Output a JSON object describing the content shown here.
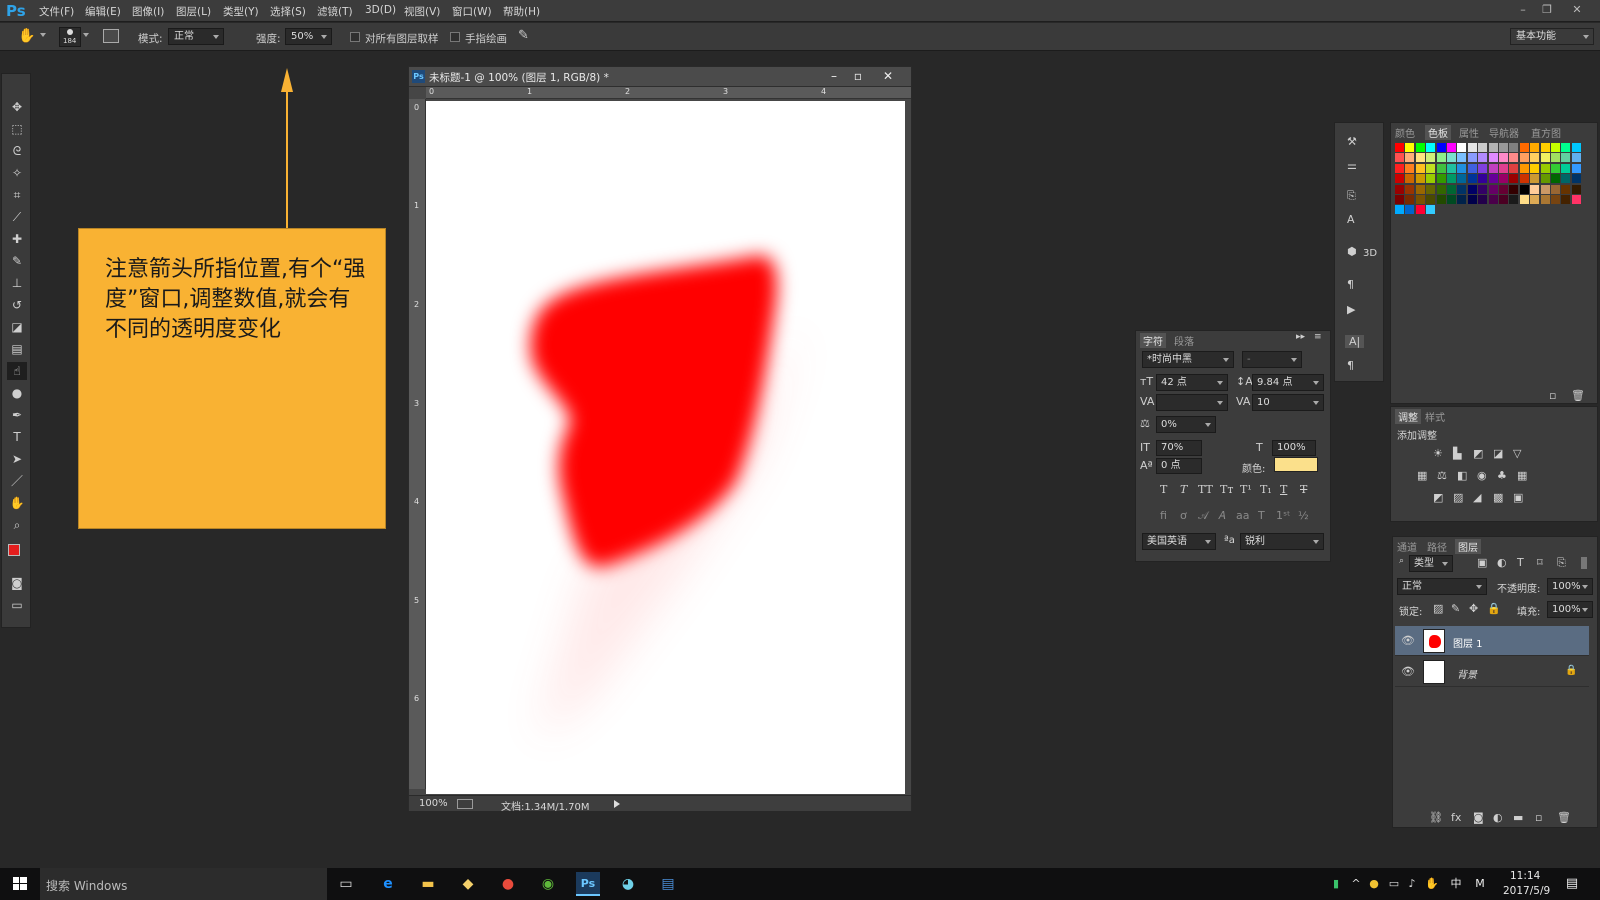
{
  "app": {
    "logo": "Ps"
  },
  "menu": [
    "文件(F)",
    "编辑(E)",
    "图像(I)",
    "图层(L)",
    "类型(Y)",
    "选择(S)",
    "滤镜(T)",
    "3D(D)",
    "视图(V)",
    "窗口(W)",
    "帮助(H)"
  ],
  "options": {
    "brush_size": "184",
    "mode_label": "模式:",
    "mode_value": "正常",
    "strength_label": "强度:",
    "strength_value": "50%",
    "sample_all_label": "对所有图层取样",
    "finger_paint_label": "手指绘画",
    "workspace": "基本功能"
  },
  "callout": {
    "text": "注意箭头所指位置,有个“强度”窗口,调整数值,就会有不同的透明度变化"
  },
  "document": {
    "title": "未标题-1 @ 100% (图层 1, RGB/8) *",
    "zoom": "100%",
    "doc_size": "文档:1.34M/1.70M",
    "ruler_top": [
      "0",
      "1",
      "2",
      "3",
      "4"
    ],
    "ruler_left": [
      "0",
      "1",
      "2",
      "3",
      "4",
      "5",
      "6"
    ]
  },
  "swatch_panel": {
    "tabs": [
      "颜色",
      "色板",
      "属性",
      "导航器",
      "直方图"
    ],
    "active_tab": "色板"
  },
  "tools_panel": {
    "label_3d": "3D"
  },
  "character_panel": {
    "tabs": [
      "字符",
      "段落"
    ],
    "font_family": "*时尚中黑",
    "font_style": "-",
    "font_size": "42 点",
    "leading": "9.84 点",
    "kerning": "",
    "tracking": "10",
    "scale_percent": "0%",
    "vertical_scale": "70%",
    "horizontal_scale": "100%",
    "baseline_shift": "0 点",
    "color_label": "颜色:",
    "language": "美国英语",
    "aa_label": "ªa",
    "antialias": "锐利",
    "color_swatch": "#fbe08b"
  },
  "adjustments_panel": {
    "tabs": [
      "调整",
      "样式"
    ],
    "title": "添加调整"
  },
  "layers_panel": {
    "tabs": [
      "通道",
      "路径",
      "图层"
    ],
    "filter": "类型",
    "blend_mode": "正常",
    "opacity_label": "不透明度:",
    "opacity": "100%",
    "lock_label": "锁定:",
    "fill_label": "填充:",
    "fill": "100%",
    "layers": [
      {
        "name": "图层 1",
        "selected": true
      },
      {
        "name": "背景",
        "selected": false
      }
    ]
  },
  "taskbar": {
    "search_placeholder": "搜索 Windows",
    "time": "11:14",
    "date": "2017/5/9",
    "ime": "中",
    "ime_mode": "M"
  },
  "colors": {
    "foreground": "#e41e1e",
    "background": "#ffffff",
    "brush_red": "#ff0000",
    "callout_bg": "#f9b233"
  }
}
